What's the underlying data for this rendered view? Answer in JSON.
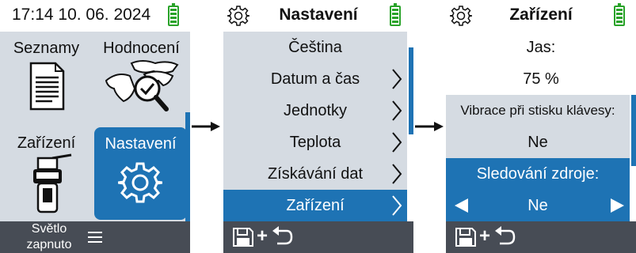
{
  "colors": {
    "accent": "#1e73b4",
    "list_bg": "#d5dbe2",
    "bar_bg": "#474c55",
    "battery": "#29a329"
  },
  "screen1": {
    "clock": "17:14 10. 06. 2024",
    "tiles": [
      {
        "label": "Seznamy",
        "icon": "document-list-icon"
      },
      {
        "label": "Hodnocení",
        "icon": "cows-check-icon"
      },
      {
        "label": "Zařízení",
        "icon": "handheld-device-icon"
      },
      {
        "label": "Nastavení",
        "icon": "gear-icon"
      }
    ],
    "bottom_line1": "Světlo",
    "bottom_line2": "zapnuto"
  },
  "screen2": {
    "title": "Nastavení",
    "items": [
      {
        "label": "Čeština"
      },
      {
        "label": "Datum a čas"
      },
      {
        "label": "Jednotky"
      },
      {
        "label": "Teplota"
      },
      {
        "label": "Získávání dat"
      },
      {
        "label": "Zařízení"
      }
    ]
  },
  "screen3": {
    "title": "Zařízení",
    "brightness_label": "Jas:",
    "brightness_value": "75 %",
    "vibration_label": "Vibrace při stisku klávesy:",
    "vibration_value": "Ne",
    "source_label": "Sledování zdroje:",
    "source_value": "Ne"
  }
}
